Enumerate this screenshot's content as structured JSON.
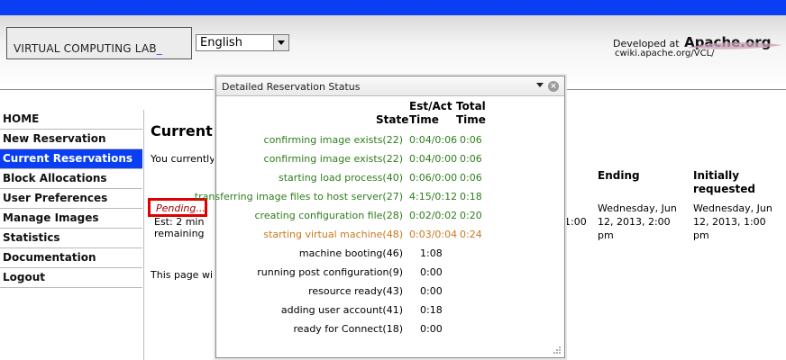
{
  "header": {
    "logo": {
      "text": "VIRTUAL COMPUTING LAB",
      "cursor": "_"
    },
    "language": {
      "selected": "English"
    },
    "credit": {
      "prefix": "Developed at",
      "brand": "Apache.org",
      "url": "cwiki.apache.org/VCL/"
    }
  },
  "nav": {
    "items": [
      {
        "label": "HOME"
      },
      {
        "label": "New Reservation"
      },
      {
        "label": "Current Reservations",
        "active": true
      },
      {
        "label": "Block Allocations"
      },
      {
        "label": "User Preferences"
      },
      {
        "label": "Manage Images"
      },
      {
        "label": "Statistics"
      },
      {
        "label": "Documentation"
      },
      {
        "label": "Logout"
      }
    ]
  },
  "main": {
    "title": "Current R",
    "intro": "You currently h",
    "pending": "Pending...",
    "estimate": "Est: 2 min remaining",
    "footer": "This page will a",
    "start_stub": "1:00",
    "ending": {
      "header": "Ending",
      "value": "Wednesday, Jun 12, 2013, 2:00 pm"
    },
    "initially": {
      "header": "Initially requested",
      "value": "Wednesday, Jun 12, 2013, 1:00 pm"
    }
  },
  "dialog": {
    "title": "Detailed Reservation Status",
    "columns": {
      "state": "State",
      "est_act": "Est/Act Time",
      "total": "Total Time"
    },
    "rows": [
      {
        "state": "confirming image exists(22)",
        "est": "0:04/0:06",
        "total": "0:06",
        "status": "done"
      },
      {
        "state": "confirming image exists(22)",
        "est": "0:04/0:00",
        "total": "0:06",
        "status": "done"
      },
      {
        "state": "starting load process(40)",
        "est": "0:06/0:00",
        "total": "0:06",
        "status": "done"
      },
      {
        "state": "transferring image files to host server(27)",
        "est": "4:15/0:12",
        "total": "0:18",
        "status": "done"
      },
      {
        "state": "creating configuration file(28)",
        "est": "0:02/0:02",
        "total": "0:20",
        "status": "done"
      },
      {
        "state": "starting virtual machine(48)",
        "est": "0:03/0:04",
        "total": "0:24",
        "status": "current"
      },
      {
        "state": "machine booting(46)",
        "est": "1:08",
        "total": "",
        "status": "pending"
      },
      {
        "state": "running post configuration(9)",
        "est": "0:00",
        "total": "",
        "status": "pending"
      },
      {
        "state": "resource ready(43)",
        "est": "0:00",
        "total": "",
        "status": "pending"
      },
      {
        "state": "adding user account(41)",
        "est": "0:18",
        "total": "",
        "status": "pending"
      },
      {
        "state": "ready for Connect(18)",
        "est": "0:00",
        "total": "",
        "status": "pending"
      }
    ]
  },
  "colors": {
    "topbar": "#0a3ef2",
    "active_nav": "#0a3ef2",
    "done": "#2e7d1c",
    "current": "#c97a1e",
    "highlight": "#e00000"
  }
}
